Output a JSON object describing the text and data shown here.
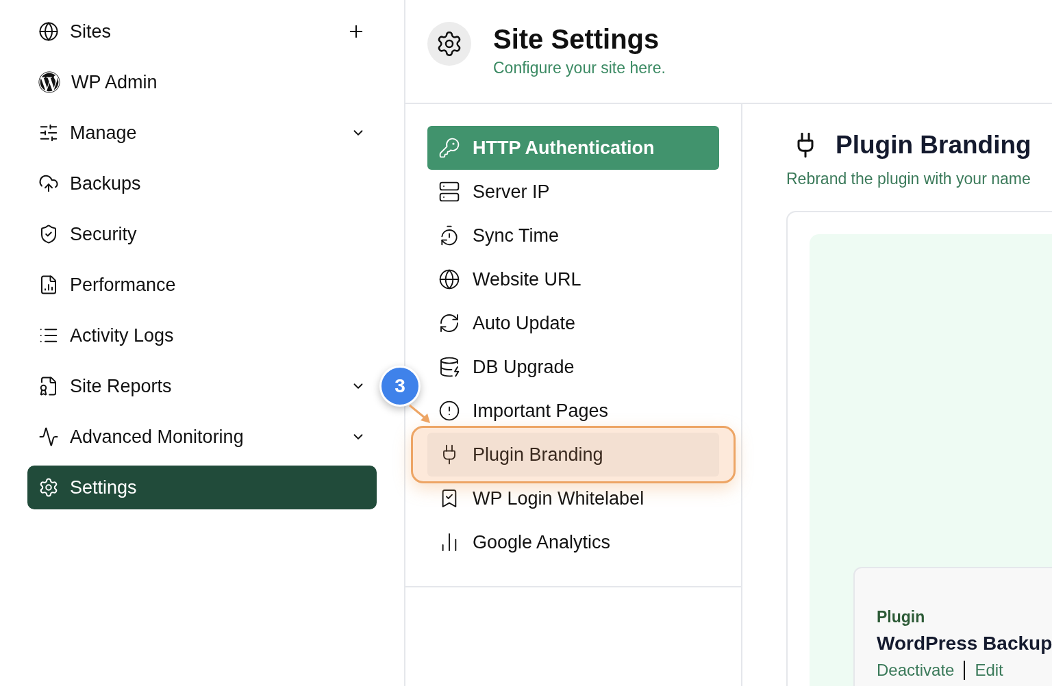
{
  "sidebar": {
    "items": [
      {
        "label": "Sites",
        "kind": "add",
        "selected": false
      },
      {
        "label": "WP Admin",
        "kind": "plain",
        "selected": false
      },
      {
        "label": "Manage",
        "kind": "expand",
        "selected": false
      },
      {
        "label": "Backups",
        "kind": "plain",
        "selected": false
      },
      {
        "label": "Security",
        "kind": "plain",
        "selected": false
      },
      {
        "label": "Performance",
        "kind": "plain",
        "selected": false
      },
      {
        "label": "Activity Logs",
        "kind": "plain",
        "selected": false
      },
      {
        "label": "Site Reports",
        "kind": "expand",
        "selected": false
      },
      {
        "label": "Advanced Monitoring",
        "kind": "expand",
        "selected": false
      },
      {
        "label": "Settings",
        "kind": "plain",
        "selected": true
      }
    ]
  },
  "header": {
    "title": "Site Settings",
    "subtitle": "Configure your site here."
  },
  "settings_nav": {
    "items": [
      {
        "label": "HTTP Authentication",
        "selected": true,
        "highlighted": false
      },
      {
        "label": "Server IP",
        "selected": false,
        "highlighted": false
      },
      {
        "label": "Sync Time",
        "selected": false,
        "highlighted": false
      },
      {
        "label": "Website URL",
        "selected": false,
        "highlighted": false
      },
      {
        "label": "Auto Update",
        "selected": false,
        "highlighted": false
      },
      {
        "label": "DB Upgrade",
        "selected": false,
        "highlighted": false
      },
      {
        "label": "Important Pages",
        "selected": false,
        "highlighted": false
      },
      {
        "label": "Plugin Branding",
        "selected": false,
        "highlighted": true
      },
      {
        "label": "WP Login Whitelabel",
        "selected": false,
        "highlighted": false
      },
      {
        "label": "Google Analytics",
        "selected": false,
        "highlighted": false
      }
    ]
  },
  "panel": {
    "title": "Plugin Branding",
    "subtitle": "Rebrand the plugin with your name",
    "preview": {
      "label": "Plugin",
      "name": "WordPress Backup",
      "actions": [
        "Deactivate",
        "Edit"
      ]
    }
  },
  "step_badge": "3"
}
